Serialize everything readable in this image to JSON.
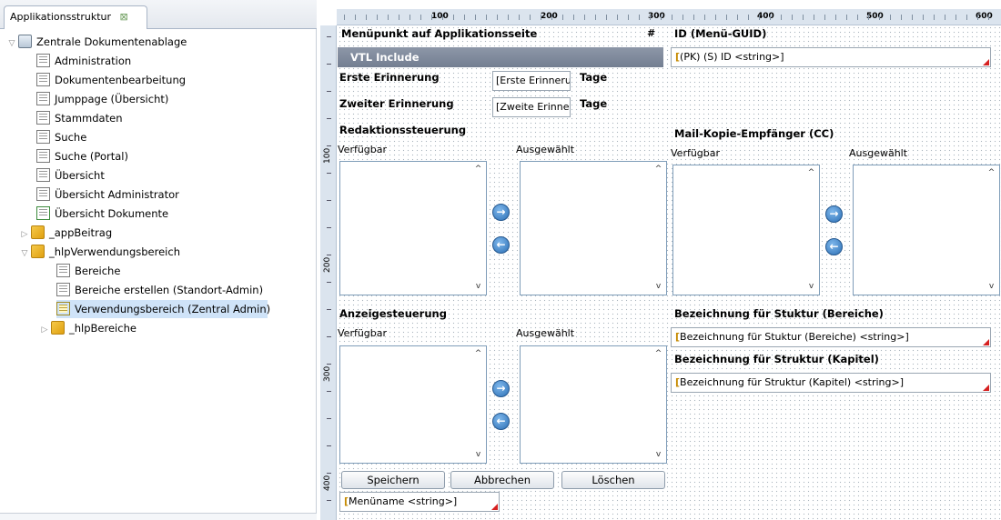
{
  "tree": {
    "tab_title": "Applikationsstruktur",
    "close_glyph": "⊠",
    "root_label": "Zentrale Dokumentenablage",
    "items": [
      {
        "label": "Administration"
      },
      {
        "label": "Dokumentenbearbeitung"
      },
      {
        "label": "Jumppage (Übersicht)"
      },
      {
        "label": "Stammdaten"
      },
      {
        "label": "Suche"
      },
      {
        "label": "Suche (Portal)"
      },
      {
        "label": "Übersicht"
      },
      {
        "label": "Übersicht Administrator"
      },
      {
        "label": "Übersicht Dokumente"
      }
    ],
    "folder_app": "_appBeitrag",
    "folder_hlp": "_hlpVerwendungsbereich",
    "sub_items": [
      {
        "label": "Bereiche"
      },
      {
        "label": "Bereiche erstellen (Standort-Admin)"
      },
      {
        "label": "Verwendungsbereich (Zentral Admin)"
      }
    ],
    "folder_bereiche": "_hlpBereiche"
  },
  "ruler": {
    "top_labels": [
      "100",
      "200",
      "300",
      "400",
      "500",
      "600"
    ],
    "left_labels": [
      "100",
      "200",
      "300",
      "400"
    ]
  },
  "form": {
    "menu_title": "Menüpunkt auf Applikationsseite",
    "hash": "#",
    "vtl_include": "VTL Include",
    "first_reminder_label": "Erste Erinnerung",
    "first_reminder_field": "Erste Erinnerung",
    "days_1": "Tage",
    "second_reminder_label": "Zweiter Erinnerung",
    "second_reminder_field": "Zweite Erinnerung",
    "days_2": "Tage",
    "redaktion_title": "Redaktionssteuerung",
    "available": "Verfügbar",
    "selected": "Ausgewählt",
    "anzeige_title": "Anzeigesteuerung",
    "id_title": "ID (Menü-GUID)",
    "id_field": "(PK) (S) ID <string>]",
    "mail_cc_title": "Mail-Kopie-Empfänger (CC)",
    "bez_bereiche_title": "Bezeichnung für Stuktur (Bereiche)",
    "bez_bereiche_field": "Bezeichnung für Stuktur (Bereiche) <string>]",
    "bez_kapitel_title": "Bezeichnung für Struktur (Kapitel)",
    "bez_kapitel_field": "Bezeichnung für Struktur (Kapitel) <string>]",
    "save": "Speichern",
    "cancel": "Abbrechen",
    "delete": "Löschen",
    "menuname_field": "Menüname <string>]",
    "field_marker": "[",
    "arrow_right": "→",
    "arrow_left": "←",
    "scroll_up": "^",
    "scroll_down": "v"
  }
}
